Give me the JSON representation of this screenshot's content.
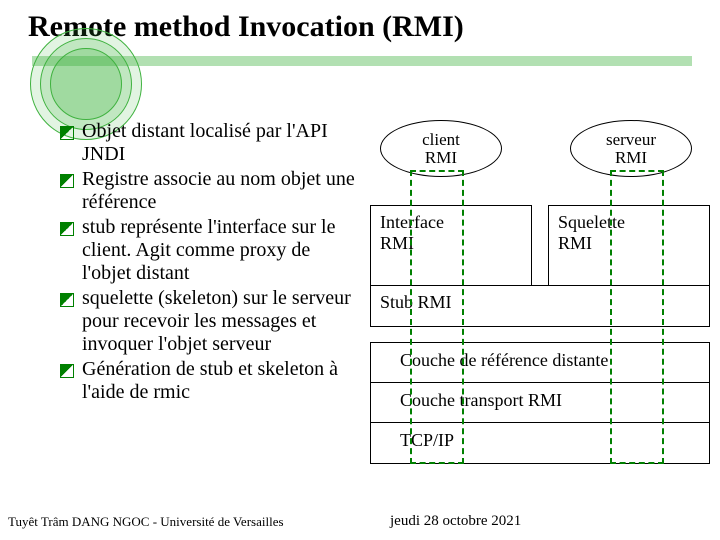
{
  "title": "Remote method Invocation (RMI)",
  "bullets": [
    "Objet distant localisé par l'API JNDI",
    "Registre associe au nom objet une référence",
    "stub représente l'interface sur le client. Agit comme proxy de l'objet distant",
    "squelette (skeleton) sur le serveur pour recevoir les messages et invoquer l'objet serveur",
    "Génération de stub et skeleton à l'aide de rmic"
  ],
  "diagram": {
    "client_ellipse": "client\nRMI",
    "server_ellipse": "serveur\nRMI",
    "interface": "Interface\nRMI",
    "skeleton": "Squelette\nRMI",
    "stub": "Stub RMI",
    "ref_layer": "Couche de référence distante",
    "transport": "Couche transport RMI",
    "tcpip": "TCP/IP"
  },
  "footer": {
    "author": "Tuyêt Trâm DANG NGOC - Université de Versailles",
    "date": "jeudi 28 octobre 2021"
  }
}
